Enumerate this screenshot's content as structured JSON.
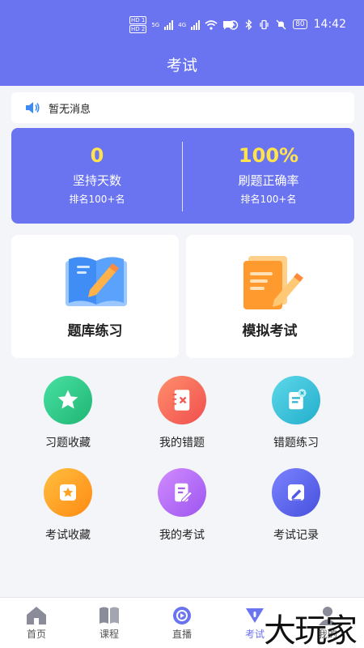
{
  "status_bar": {
    "hd1": "HD 1",
    "hd2": "HD 2",
    "net": "5G",
    "net2": "4G",
    "battery": "80",
    "time": "14:42"
  },
  "header": {
    "title": "考试"
  },
  "notice": {
    "text": "暂无消息",
    "icon": "speaker-icon"
  },
  "stats": [
    {
      "value": "0",
      "label": "坚持天数",
      "rank": "排名100+名"
    },
    {
      "value": "100%",
      "label": "刷题正确率",
      "rank": "排名100+名"
    }
  ],
  "cards": [
    {
      "label": "题库练习",
      "icon": "book-pencil-icon"
    },
    {
      "label": "模拟考试",
      "icon": "paper-pencil-icon"
    }
  ],
  "grid": [
    {
      "label": "习题收藏",
      "icon": "star-icon",
      "color": "#2ec98a"
    },
    {
      "label": "我的错题",
      "icon": "wrong-notebook-icon",
      "color": "#ff6f5c"
    },
    {
      "label": "错题练习",
      "icon": "scroll-icon",
      "color": "#32c3d9"
    },
    {
      "label": "考试收藏",
      "icon": "star-note-icon",
      "color": "#ffa21f"
    },
    {
      "label": "我的考试",
      "icon": "exam-paper-icon",
      "color": "#b068f2"
    },
    {
      "label": "考试记录",
      "icon": "record-edit-icon",
      "color": "#5b62e8"
    }
  ],
  "tabs": [
    {
      "label": "首页",
      "icon": "home-icon"
    },
    {
      "label": "课程",
      "icon": "book-icon"
    },
    {
      "label": "直播",
      "icon": "live-icon"
    },
    {
      "label": "考试",
      "icon": "exam-icon",
      "active": true
    },
    {
      "label": "我的",
      "icon": "profile-icon"
    }
  ],
  "watermark": "大玩家",
  "colors": {
    "primary": "#6a73f0",
    "highlight": "#ffe34d"
  }
}
